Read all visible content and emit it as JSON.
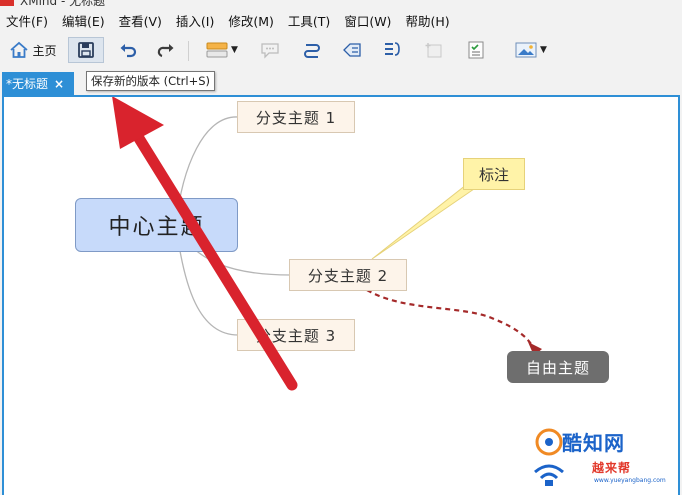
{
  "window": {
    "title": "XMind - 无标题"
  },
  "menu": [
    "文件(F)",
    "编辑(E)",
    "查看(V)",
    "插入(I)",
    "修改(M)",
    "工具(T)",
    "窗口(W)",
    "帮助(H)"
  ],
  "toolbar": {
    "home_label": "主页"
  },
  "tabs": [
    {
      "label": "*无标题",
      "close": "×"
    }
  ],
  "tooltip": "保存新的版本 (Ctrl+S)",
  "mindmap": {
    "central": "中心主题",
    "branches": [
      "分支主题 1",
      "分支主题 2",
      "分支主题 3"
    ],
    "callout": "标注",
    "floating": "自由主题"
  },
  "watermark": {
    "brand": "酷知网",
    "sub": "越来帮",
    "url": "www.yueyangbang.com"
  },
  "colors": {
    "accent": "#2e8fd6",
    "central_fill": "#c7dafa",
    "branch_fill": "#fdf4ea",
    "callout_fill": "#fff3a8",
    "floating_fill": "#6e6e6e",
    "relationship": "#a52a2a",
    "annotation_arrow": "#d9232d"
  }
}
